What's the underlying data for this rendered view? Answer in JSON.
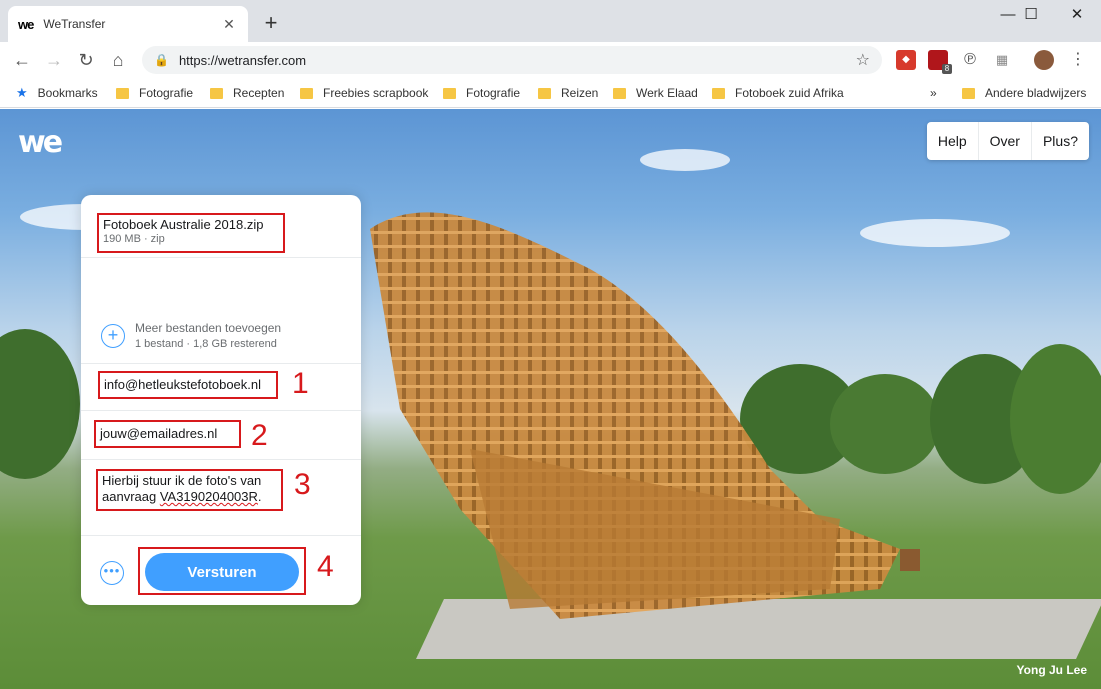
{
  "browser": {
    "tab_title": "WeTransfer",
    "tab_logo": "we",
    "url": "https://wetransfer.com",
    "ext_badge": "8",
    "bookmarks": [
      {
        "label": "Bookmarks",
        "icon": "star-icon"
      },
      {
        "label": "Fotografie",
        "icon": "folder-icon"
      },
      {
        "label": "Recepten",
        "icon": "folder-icon"
      },
      {
        "label": "Freebies scrapbook",
        "icon": "folder-icon"
      },
      {
        "label": "Fotografie",
        "icon": "folder-icon"
      },
      {
        "label": "Reizen",
        "icon": "folder-icon"
      },
      {
        "label": "Werk Elaad",
        "icon": "folder-icon"
      },
      {
        "label": "Fotoboek zuid Afrika",
        "icon": "folder-icon"
      }
    ],
    "other_bookmarks": "Andere bladwijzers",
    "overflow": "»"
  },
  "site": {
    "logo": "we",
    "menu": [
      "Help",
      "Over",
      "Plus?"
    ],
    "photo_credit": "Yong Ju Lee"
  },
  "panel": {
    "file_name": "Fotoboek Australie 2018.zip",
    "file_meta": "190 MB · zip",
    "add_more_title": "Meer bestanden toevoegen",
    "add_more_sub": "1 bestand · 1,8 GB resterend",
    "email_to": "info@hetleukstefotoboek.nl",
    "email_from": "jouw@emailadres.nl",
    "message_line1": "Hierbij stuur ik de foto's van",
    "message_prefix": "aanvraag ",
    "message_code": "VA3190204003R",
    "message_suffix": ".",
    "send_label": "Versturen",
    "annotations": [
      "1",
      "2",
      "3",
      "4"
    ]
  },
  "colors": {
    "accent": "#409fff",
    "annotation_red": "#d7191c"
  }
}
